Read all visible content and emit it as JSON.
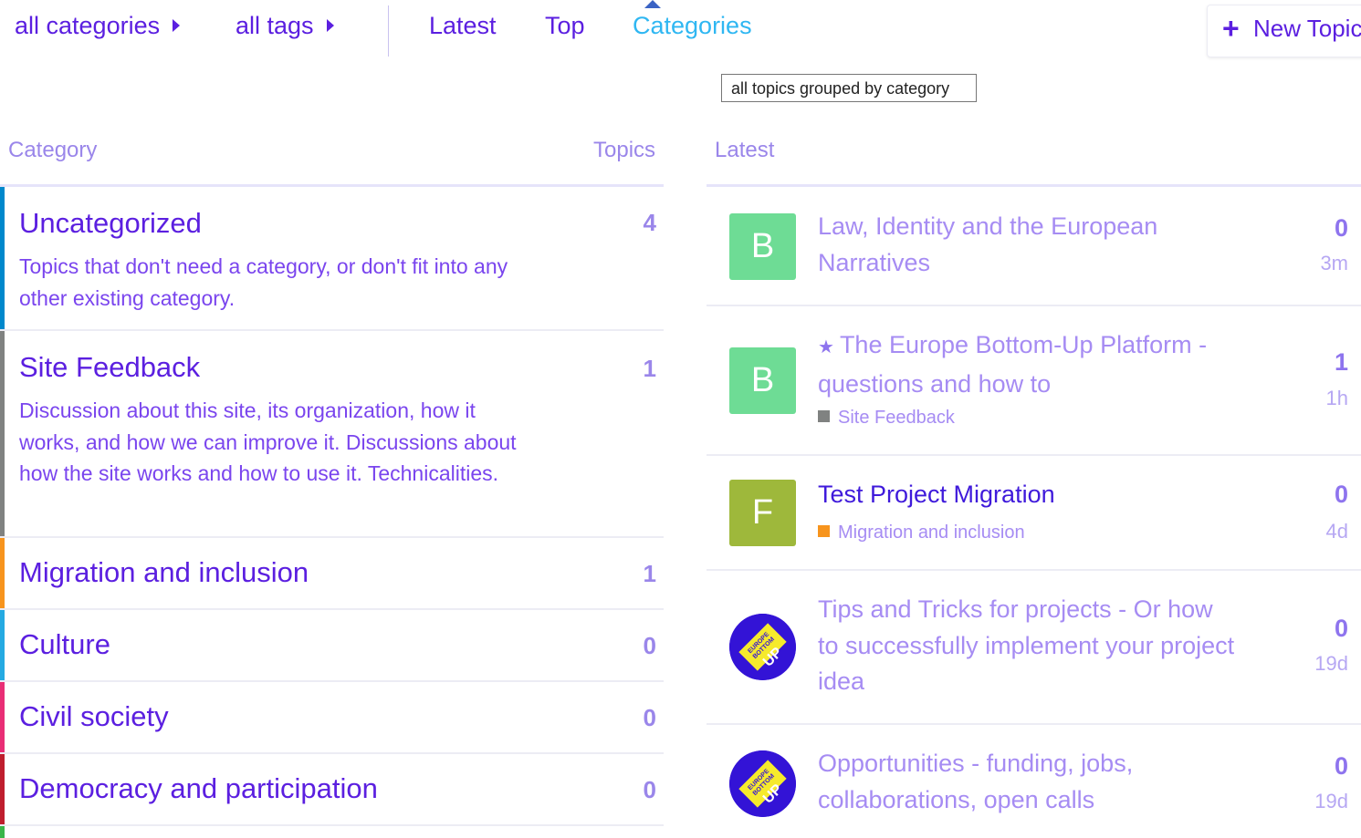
{
  "nav": {
    "categories_dropdown": "all categories",
    "tags_dropdown": "all tags",
    "tabs": [
      "Latest",
      "Top",
      "Categories"
    ],
    "active_tab": "Categories",
    "new_topic": "New Topic",
    "tooltip": "all topics grouped by category"
  },
  "table": {
    "col_category": "Category",
    "col_topics": "Topics",
    "col_latest": "Latest"
  },
  "categories": [
    {
      "name": "Uncategorized",
      "description": "Topics that don't need a category, or don't fit into any other existing category.",
      "topics": "4",
      "color": "#0088cc"
    },
    {
      "name": "Site Feedback",
      "description": "Discussion about this site, its organization, how it works, and how we can improve it. Discussions about how the site works and how to use it. Technicalities.",
      "topics": "1",
      "color": "#808281"
    },
    {
      "name": "Migration and inclusion",
      "description": "",
      "topics": "1",
      "color": "#f7941d"
    },
    {
      "name": "Culture",
      "description": "",
      "topics": "0",
      "color": "#25aae2"
    },
    {
      "name": "Civil society",
      "description": "",
      "topics": "0",
      "color": "#e92e76"
    },
    {
      "name": "Democracy and participation",
      "description": "",
      "topics": "0",
      "color": "#bf1e2e"
    }
  ],
  "latest": [
    {
      "title": "Law, Identity and the European Narratives",
      "category": "",
      "category_color": "",
      "pinned": false,
      "replies": "0",
      "age": "3m",
      "avatar_letter": "B",
      "avatar_color": "#6edc95",
      "avatar_type": "letter",
      "read": true
    },
    {
      "title": "The Europe Bottom-Up Platform - questions and how to",
      "category": "Site Feedback",
      "category_color": "#808281",
      "pinned": true,
      "pin_icon": "pin-icon",
      "replies": "1",
      "age": "1h",
      "avatar_letter": "B",
      "avatar_color": "#6edc95",
      "avatar_type": "letter",
      "read": true
    },
    {
      "title": "Test Project Migration",
      "category": "Migration and inclusion",
      "category_color": "#f7941d",
      "pinned": false,
      "replies": "0",
      "age": "4d",
      "avatar_letter": "F",
      "avatar_color": "#9eb83b",
      "avatar_type": "letter",
      "read": false
    },
    {
      "title": "Tips and Tricks for projects - Or how to successfully implement your project idea",
      "category": "",
      "category_color": "",
      "pinned": false,
      "replies": "0",
      "age": "19d",
      "avatar_logo_text": [
        "EUROPE",
        "BOTTOM",
        "UP"
      ],
      "avatar_type": "logo",
      "read": true
    },
    {
      "title": "Opportunities - funding, jobs, collaborations, open calls",
      "category": "",
      "category_color": "",
      "pinned": false,
      "replies": "0",
      "age": "19d",
      "avatar_logo_text": [
        "EUROPE",
        "BOTTOM",
        "UP"
      ],
      "avatar_type": "logo",
      "read": true
    }
  ],
  "colors": {
    "link": "#5b1fe0",
    "active_tab": "#2fb7f2",
    "muted": "#a68cf3"
  }
}
